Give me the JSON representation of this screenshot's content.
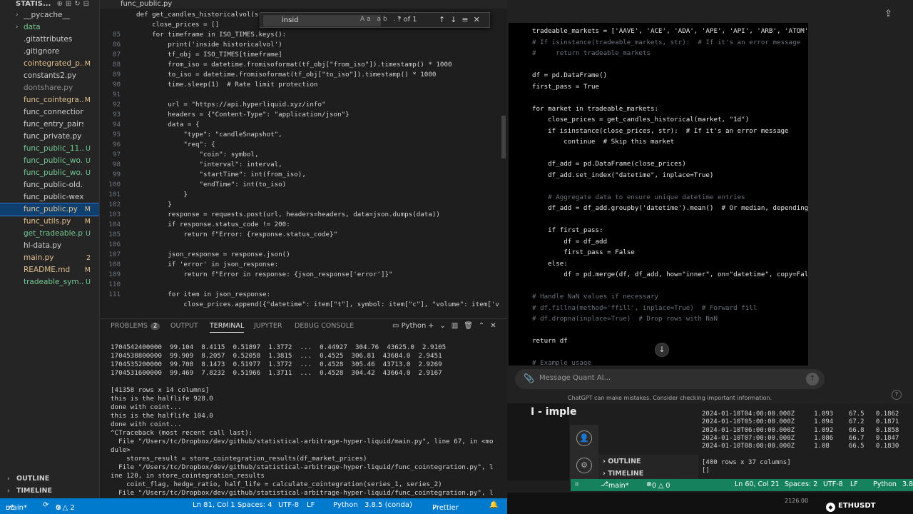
{
  "explorer": {
    "title": "STATIS...",
    "items": [
      {
        "name": "__pycache__",
        "status": "",
        "folder": true,
        "color": "#cccccc"
      },
      {
        "name": "data",
        "status": "",
        "folder": true,
        "color": "#73c991"
      },
      {
        "name": ".gitattributes",
        "status": "",
        "folder": false,
        "color": "#cccccc"
      },
      {
        "name": ".gitignore",
        "status": "",
        "folder": false,
        "color": "#cccccc"
      },
      {
        "name": "cointegrated_p...",
        "status": "M",
        "folder": false,
        "color": "#e2c08d"
      },
      {
        "name": "constants2.py",
        "status": "",
        "folder": false,
        "color": "#cccccc"
      },
      {
        "name": "dontshare.py",
        "status": "",
        "folder": false,
        "color": "#8c8c8c"
      },
      {
        "name": "func_cointegra...",
        "status": "M",
        "folder": false,
        "color": "#e2c08d"
      },
      {
        "name": "func_connections.py",
        "status": "",
        "folder": false,
        "color": "#cccccc"
      },
      {
        "name": "func_entry_pairs.py",
        "status": "",
        "folder": false,
        "color": "#cccccc"
      },
      {
        "name": "func_private.py",
        "status": "",
        "folder": false,
        "color": "#cccccc"
      },
      {
        "name": "func_public_11...",
        "status": "U",
        "folder": false,
        "color": "#73c991"
      },
      {
        "name": "func_public_wo...",
        "status": "U",
        "folder": false,
        "color": "#73c991"
      },
      {
        "name": "func_public_wo...",
        "status": "U",
        "folder": false,
        "color": "#73c991"
      },
      {
        "name": "func_public-old.py",
        "status": "",
        "folder": false,
        "color": "#cccccc"
      },
      {
        "name": "func_public-wex.py",
        "status": "",
        "folder": false,
        "color": "#cccccc"
      },
      {
        "name": "func_public.py",
        "status": "M",
        "folder": false,
        "color": "#e2c08d",
        "selected": true
      },
      {
        "name": "func_utils.py",
        "status": "M",
        "folder": false,
        "color": "#e2c08d"
      },
      {
        "name": "get_tradeable.py",
        "status": "U",
        "folder": false,
        "color": "#73c991"
      },
      {
        "name": "hl-data.py",
        "status": "",
        "folder": false,
        "color": "#cccccc"
      },
      {
        "name": "main.py",
        "status": "2",
        "folder": false,
        "color": "#e2c08d"
      },
      {
        "name": "README.md",
        "status": "M",
        "folder": false,
        "color": "#e2c08d"
      },
      {
        "name": "tradeable_sym...",
        "status": "U",
        "folder": false,
        "color": "#73c991"
      }
    ],
    "outline": "OUTLINE",
    "timeline": "TIMELINE"
  },
  "editor": {
    "tab": "func_public.py",
    "find": {
      "query": "insid",
      "count": "? of 1"
    },
    "lines": [
      {
        "n": "",
        "t": "def get_candles_historicalvol(s"
      },
      {
        "n": "",
        "t": "    close_prices = []"
      },
      {
        "n": "85",
        "t": "    for timeframe in ISO_TIMES.keys():"
      },
      {
        "n": "86",
        "t": "        print('inside historicalvol')"
      },
      {
        "n": "87",
        "t": "        tf_obj = ISO_TIMES[timeframe]"
      },
      {
        "n": "88",
        "t": "        from_iso = datetime.fromisoformat(tf_obj[\"from_iso\"]).timestamp() * 1000"
      },
      {
        "n": "89",
        "t": "        to_iso = datetime.fromisoformat(tf_obj[\"to_iso\"]).timestamp() * 1000"
      },
      {
        "n": "90",
        "t": "        time.sleep(1)  # Rate limit protection"
      },
      {
        "n": "91",
        "t": ""
      },
      {
        "n": "92",
        "t": "        url = \"https://api.hyperliquid.xyz/info\""
      },
      {
        "n": "93",
        "t": "        headers = {\"Content-Type\": \"application/json\"}"
      },
      {
        "n": "94",
        "t": "        data = {"
      },
      {
        "n": "95",
        "t": "            \"type\": \"candleSnapshot\","
      },
      {
        "n": "96",
        "t": "            \"req\": {"
      },
      {
        "n": "97",
        "t": "                \"coin\": symbol,"
      },
      {
        "n": "98",
        "t": "                \"interval\": interval,"
      },
      {
        "n": "99",
        "t": "                \"startTime\": int(from_iso),"
      },
      {
        "n": "100",
        "t": "                \"endTime\": int(to_iso)"
      },
      {
        "n": "101",
        "t": "            }"
      },
      {
        "n": "102",
        "t": "        }"
      },
      {
        "n": "103",
        "t": "        response = requests.post(url, headers=headers, data=json.dumps(data))"
      },
      {
        "n": "104",
        "t": "        if response.status_code != 200:"
      },
      {
        "n": "105",
        "t": "            return f\"Error: {response.status_code}\""
      },
      {
        "n": "106",
        "t": ""
      },
      {
        "n": "107",
        "t": "        json_response = response.json()"
      },
      {
        "n": "108",
        "t": "        if 'error' in json_response:"
      },
      {
        "n": "109",
        "t": "            return f\"Error in response: {json_response['error']}\""
      },
      {
        "n": "110",
        "t": ""
      },
      {
        "n": "111",
        "t": "        for item in json_response:"
      },
      {
        "n": "",
        "t": "            close_prices.append({\"datetime\": item[\"t\"], symbol: item[\"c\"], \"volume\": item['v"
      }
    ]
  },
  "panel": {
    "tabs": [
      {
        "label": "PROBLEMS",
        "badge": "2"
      },
      {
        "label": "OUTPUT",
        "badge": ""
      },
      {
        "label": "TERMINAL",
        "badge": ""
      },
      {
        "label": "JUPYTER",
        "badge": ""
      },
      {
        "label": "DEBUG CONSOLE",
        "badge": ""
      }
    ],
    "shell": "Python",
    "terminal": [
      "1704542400000  99.104  8.4115  0.51897  1.3772  ...  0.44927  304.76  43625.0  2.9105",
      "1704538800000  99.909  8.2057  0.52058  1.3815  ...  0.4525  306.81  43684.0  2.9451",
      "1704535200000  99.708  8.1473  0.51977  1.3772  ...  0.4528  305.46  43713.0  2.9269",
      "1704531600000  99.469  7.8232  0.51966  1.3711  ...  0.4528  304.42  43664.0  2.9167",
      "",
      "[41358 rows x 14 columns]",
      "this is the halflife 928.0",
      "done with coint...",
      "this is the halflife 104.0",
      "done with coint...",
      "^CTraceback (most recent call last):",
      "  File \"/Users/tc/Dropbox/dev/github/statistical-arbitrage-hyper-liquid/main.py\", line 67, in <mo",
      "dule>",
      "    stores_result = store_cointegration_results(df_market_prices)",
      "  File \"/Users/tc/Dropbox/dev/github/statistical-arbitrage-hyper-liquid/func_cointegration.py\", l",
      "ine 120, in store_cointegration_results",
      "    coint_flag, hedge_ratio, half_life = calculate_cointegration(series_1, series_2)",
      "  File \"/Users/tc/Dropbox/dev/github/statistical-arbitrage-hyper-liquid/func_cointegration.py\", l"
    ]
  },
  "status": {
    "branch": "main*",
    "problems": "0 △ 2",
    "position": "Ln 81, Col 1",
    "spaces": "Spaces: 4",
    "encoding": "UTF-8",
    "eol": "LF",
    "language": "Python",
    "interpreter": "3.8.5 (conda)",
    "formatter": "Prettier"
  },
  "chat": {
    "code": [
      {
        "t": "tradeable_markets = ['AAVE', 'ACE', 'ADA', 'APE', 'API', 'ARB', 'ATOM'",
        "c": "default"
      },
      {
        "t": "# If isinstance(tradeable_markets, str):  # If it's an error message",
        "c": "cm"
      },
      {
        "t": "#     return tradeable_markets",
        "c": "cm"
      },
      {
        "t": "",
        "c": "default"
      },
      {
        "t": "df = pd.DataFrame()",
        "c": "default"
      },
      {
        "t": "first_pass = True",
        "c": "default"
      },
      {
        "t": "",
        "c": "default"
      },
      {
        "t": "for market in tradeable_markets:",
        "c": "default"
      },
      {
        "t": "    close_prices = get_candles_historical(market, \"1d\")",
        "c": "default"
      },
      {
        "t": "    if isinstance(close_prices, str):  # If it's an error message",
        "c": "default"
      },
      {
        "t": "        continue  # Skip this market",
        "c": "default"
      },
      {
        "t": "",
        "c": "default"
      },
      {
        "t": "    df_add = pd.DataFrame(close_prices)",
        "c": "default"
      },
      {
        "t": "    df_add.set_index(\"datetime\", inplace=True)",
        "c": "default"
      },
      {
        "t": "",
        "c": "default"
      },
      {
        "t": "    # Aggregate data to ensure unique datetime entries",
        "c": "cm"
      },
      {
        "t": "    df_add = df_add.groupby('datetime').mean()  # Or median, depending",
        "c": "default"
      },
      {
        "t": "",
        "c": "default"
      },
      {
        "t": "    if first_pass:",
        "c": "default"
      },
      {
        "t": "        df = df_add",
        "c": "default"
      },
      {
        "t": "        first_pass = False",
        "c": "default"
      },
      {
        "t": "    else:",
        "c": "default"
      },
      {
        "t": "        df = pd.merge(df, df_add, how=\"inner\", on=\"datetime\", copy=Fals",
        "c": "default"
      },
      {
        "t": "",
        "c": "default"
      },
      {
        "t": "# Handle NaN values if necessary",
        "c": "cm"
      },
      {
        "t": "# df.fillna(method='ffill', inplace=True)  # Forward fill",
        "c": "cm"
      },
      {
        "t": "# df.dropna(inplace=True)  # Drop rows with NaN",
        "c": "cm"
      },
      {
        "t": "",
        "c": "default"
      },
      {
        "t": "return df",
        "c": "default"
      },
      {
        "t": "",
        "c": "default"
      },
      {
        "t": "# Example usage",
        "c": "cm"
      }
    ],
    "placeholder": "Message Quant AI...",
    "disclaimer": "ChatGPT can make mistakes. Consider checking important information."
  },
  "vs2": {
    "title": "I - imple",
    "outline": "OUTLINE",
    "timeline": "TIMELINE",
    "rows": [
      "2024-01-10T04:00:00.000Z     1.093    67.5   0.1862",
      "2024-01-10T05:00:00.000Z     1.094    67.2   0.1871",
      "2024-01-10T06:00:00.000Z     1.092    66.8   0.1858",
      "2024-01-10T07:00:00.000Z     1.086    66.7   0.1847",
      "2024-01-10T08:00:00.000Z     1.08     66.5   0.1830",
      "",
      "[400 rows x 37 columns]",
      "[]"
    ],
    "status": {
      "branch": "main*",
      "problems": "0 △ 0",
      "position": "Ln 60, Col 21",
      "spaces": "Spaces: 2",
      "encoding": "UTF-8",
      "eol": "LF",
      "language": "Python",
      "version": "3.8"
    },
    "price": "2126.00",
    "ticker": "ETHUSDT"
  }
}
